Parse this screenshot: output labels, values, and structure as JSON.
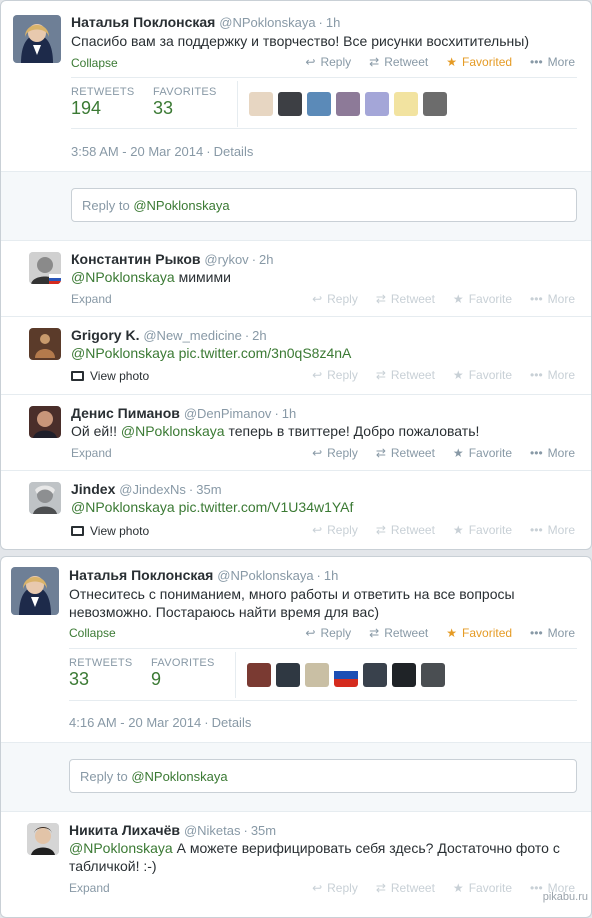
{
  "card1": {
    "main": {
      "name": "Наталья Поклонская",
      "handle": "@NPoklonskaya",
      "time": "1h",
      "text": "Спасибо вам за поддержку и творчество! Все рисунки восхитительны)",
      "collapse": "Collapse",
      "actions": {
        "reply": "Reply",
        "retweet": "Retweet",
        "favorite": "Favorited",
        "more": "More"
      },
      "retweets_label": "RETWEETS",
      "retweets": "194",
      "favorites_label": "FAVORITES",
      "favorites": "33",
      "datetime": "3:58 AM - 20 Mar 2014",
      "details": "Details"
    },
    "reply_prefix": "Reply to ",
    "reply_mention": "@NPoklonskaya",
    "replies": [
      {
        "name": "Константин Рыков",
        "handle": "@rykov",
        "time": "2h",
        "mention": "@NPoklonskaya",
        "text": " мимими",
        "link": "",
        "footer": "Expand"
      },
      {
        "name": "Grigory K.",
        "handle": "@New_medicine",
        "time": "2h",
        "mention": "@NPoklonskaya",
        "text": " ",
        "link": "pic.twitter.com/3n0qS8z4nA",
        "footer": "View photo"
      },
      {
        "name": "Денис Пиманов",
        "handle": "@DenPimanov",
        "time": "1h",
        "pre": "Ой ей!! ",
        "mention": "@NPoklonskaya",
        "text": " теперь в твиттере! Добро пожаловать!",
        "link": "",
        "footer": "Expand"
      },
      {
        "name": "Jindex",
        "handle": "@JindexNs",
        "time": "35m",
        "mention": "@NPoklonskaya",
        "text": " ",
        "link": "pic.twitter.com/V1U34w1YAf",
        "footer": "View photo"
      }
    ],
    "reply_actions": {
      "reply": "Reply",
      "retweet": "Retweet",
      "favorite": "Favorite",
      "more": "More"
    }
  },
  "card2": {
    "main": {
      "name": "Наталья Поклонская",
      "handle": "@NPoklonskaya",
      "time": "1h",
      "text1": "Отнеситесь с пониманием, много работы и ответить на все вопросы",
      "text2": "невозможно. Постараюсь найти время для вас)",
      "collapse": "Collapse",
      "actions": {
        "reply": "Reply",
        "retweet": "Retweet",
        "favorite": "Favorited",
        "more": "More"
      },
      "retweets_label": "RETWEETS",
      "retweets": "33",
      "favorites_label": "FAVORITES",
      "favorites": "9",
      "datetime": "4:16 AM - 20 Mar 2014",
      "details": "Details"
    },
    "reply_prefix": "Reply to ",
    "reply_mention": "@NPoklonskaya",
    "reply": {
      "name": "Никита Лихачёв",
      "handle": "@Niketas",
      "time": "35m",
      "mention": "@NPoklonskaya",
      "text1": " А можете верифицировать себя здесь? Достаточно фото с",
      "text2": "табличкой! :-)",
      "footer": "Expand"
    }
  },
  "watermark": "pikabu.ru",
  "colors": {
    "link": "#3b7a34",
    "muted": "#8899a6",
    "favorited": "#e59b25",
    "border": "#e6ecf0"
  }
}
